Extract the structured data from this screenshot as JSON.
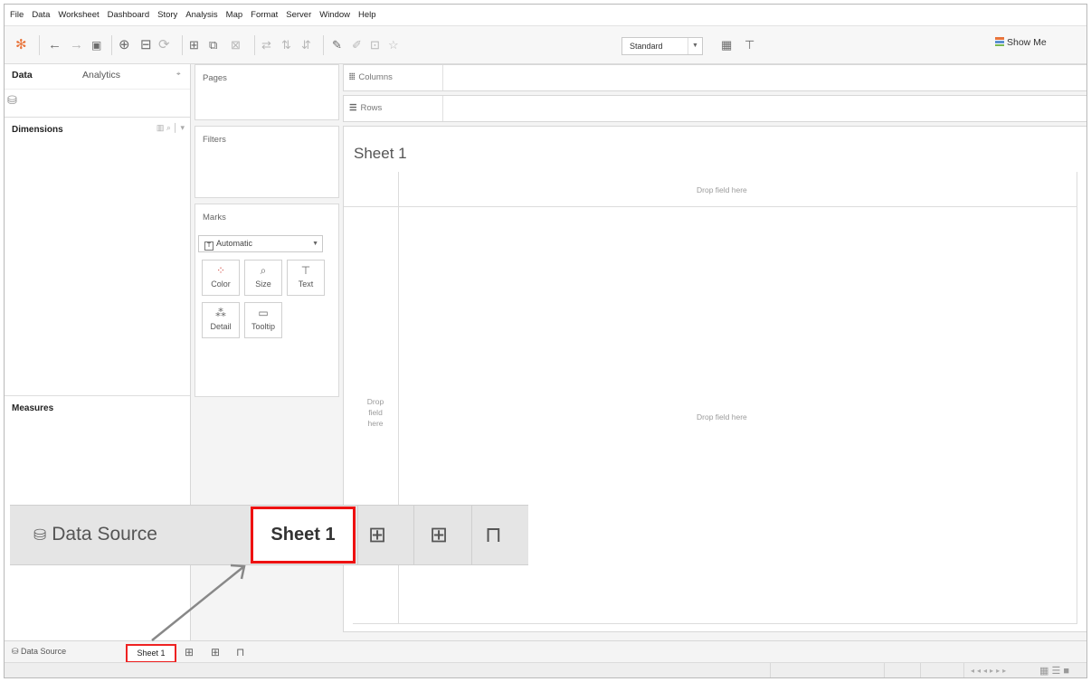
{
  "menu": [
    "File",
    "Data",
    "Worksheet",
    "Dashboard",
    "Story",
    "Analysis",
    "Map",
    "Format",
    "Server",
    "Window",
    "Help"
  ],
  "toolbar": {
    "standard_value": "Standard",
    "show_me_label": "Show Me"
  },
  "data_pane": {
    "tabs": [
      "Data",
      "Analytics"
    ],
    "dimensions_label": "Dimensions",
    "measures_label": "Measures"
  },
  "shelves": {
    "pages_label": "Pages",
    "filters_label": "Filters",
    "marks_label": "Marks",
    "mark_type": "Automatic",
    "mark_buttons": [
      "Color",
      "Size",
      "Text",
      "Detail",
      "Tooltip"
    ],
    "columns_label": "Columns",
    "rows_label": "Rows"
  },
  "view": {
    "title": "Sheet 1",
    "drop_top": "Drop field here",
    "drop_center": "Drop field here",
    "drop_left": [
      "Drop",
      "field",
      "here"
    ]
  },
  "tabs": {
    "data_source": "Data Source",
    "sheet": "Sheet 1"
  },
  "callout": {
    "data_source": "Data Source",
    "sheet": "Sheet 1"
  },
  "colors": {
    "highlight": "#e11111",
    "show_me_accent": "#e8743b"
  }
}
